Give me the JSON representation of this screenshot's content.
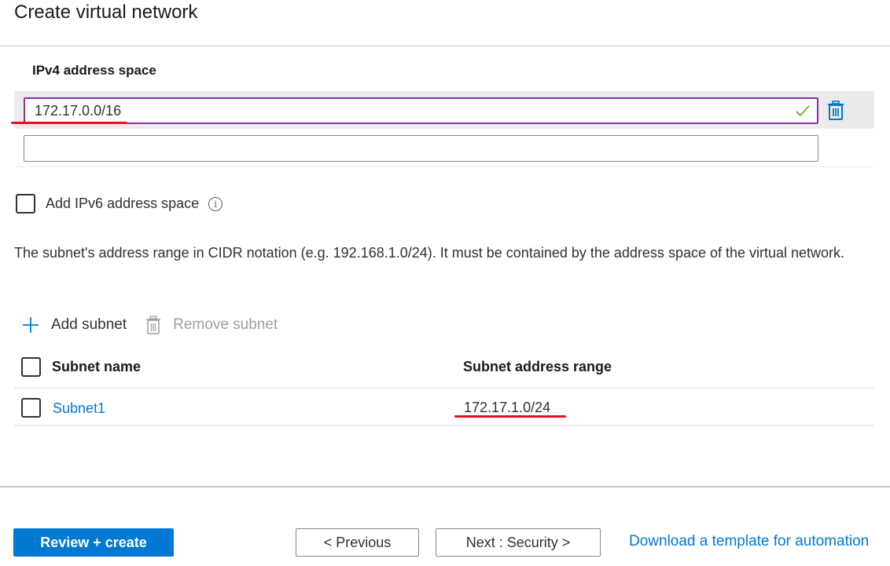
{
  "header": {
    "title": "Create virtual network"
  },
  "ipv4": {
    "label": "IPv4 address space",
    "entries": [
      {
        "value": "172.17.0.0/16",
        "valid": true
      },
      {
        "value": ""
      }
    ]
  },
  "ipv6": {
    "checkbox_label": "Add IPv6 address space",
    "checked": false,
    "info_icon": "info-icon"
  },
  "description": "The subnet's address range in CIDR notation (e.g. 192.168.1.0/24). It must be contained by the address space of the virtual network.",
  "toolbar": {
    "add_label": "Add subnet",
    "remove_label": "Remove subnet"
  },
  "subnets": {
    "columns": [
      "Subnet name",
      "Subnet address range"
    ],
    "rows": [
      {
        "name": "Subnet1",
        "range": "172.17.1.0/24"
      }
    ]
  },
  "footer": {
    "review_create": "Review + create",
    "previous": "< Previous",
    "next": "Next : Security >",
    "download_link": "Download a template for automation"
  },
  "colors": {
    "accent": "#0078d4",
    "focus_border": "#8a2da5",
    "valid_check": "#57a300",
    "annotation_red": "#e81123"
  }
}
